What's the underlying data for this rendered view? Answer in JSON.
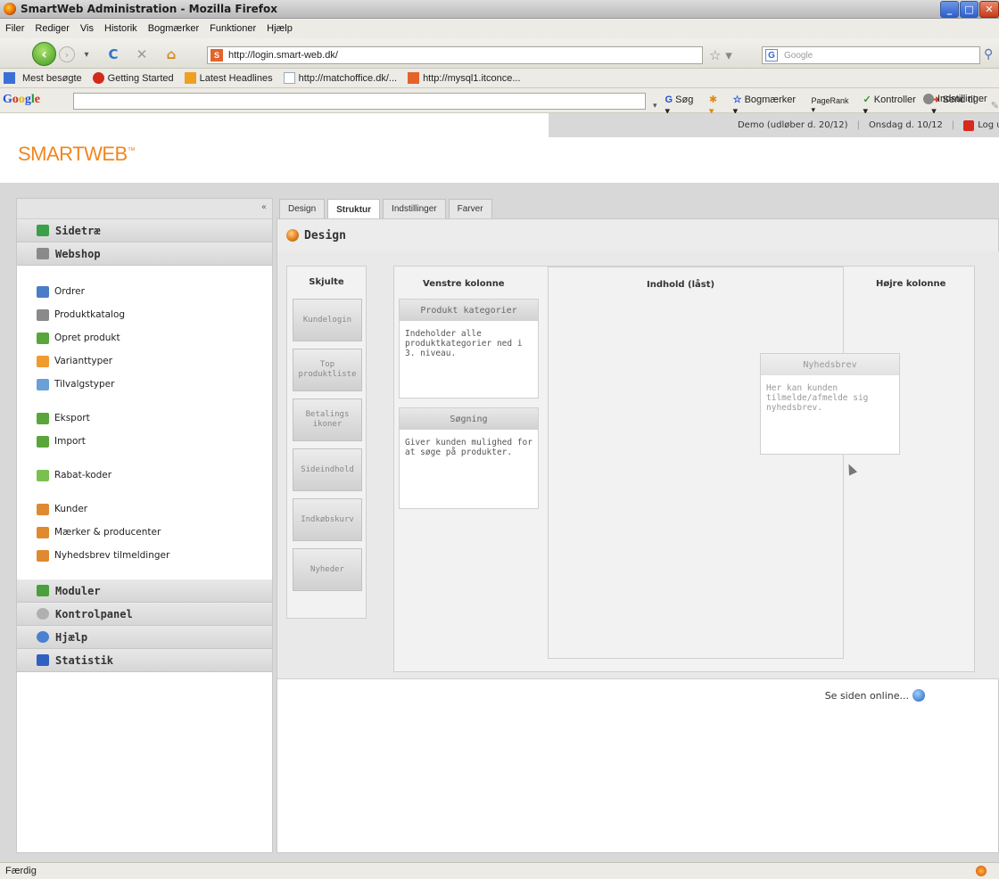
{
  "window": {
    "title": "SmartWeb Administration - Mozilla Firefox"
  },
  "menubar": [
    "Filer",
    "Rediger",
    "Vis",
    "Historik",
    "Bogmærker",
    "Funktioner",
    "Hjælp"
  ],
  "navbar": {
    "url": "http://login.smart-web.dk/",
    "search_placeholder": "Google"
  },
  "bookmarks": [
    {
      "label": "Mest besøgte",
      "color": "#3a6fd6"
    },
    {
      "label": "Getting Started",
      "color": "#d22a1a"
    },
    {
      "label": "Latest Headlines",
      "color": "#f0a020"
    },
    {
      "label": "http://matchoffice.dk/...",
      "color": "#ffffff"
    },
    {
      "label": "http://mysql1.itconce...",
      "color": "#e4632a"
    }
  ],
  "gtoolbar": {
    "logo": "Google",
    "items": [
      "Søg",
      "Bogmærker",
      "PageRank",
      "Kontroller",
      "Send til"
    ],
    "settings": "Indstillinger"
  },
  "page": {
    "brand": "SMARTWEB",
    "brand_tm": "™",
    "status_left": "Demo (udløber d. 20/12)",
    "status_date": "Onsdag d. 10/12",
    "logout": "Log ud",
    "collapse": "«",
    "sidebar": {
      "sections_top": [
        {
          "label": "Sidetræ",
          "icon": "sitemap-icon",
          "color": "#3aa04a"
        },
        {
          "label": "Webshop",
          "icon": "cart-icon",
          "color": "#8a8a8a"
        }
      ],
      "groups": [
        [
          {
            "label": "Ordrer",
            "icon": "order-icon",
            "color": "#4b7cc8"
          },
          {
            "label": "Produktkatalog",
            "icon": "catalog-icon",
            "color": "#8a8a8a"
          },
          {
            "label": "Opret produkt",
            "icon": "add-product-icon",
            "color": "#5aa63a"
          },
          {
            "label": "Varianttyper",
            "icon": "variant-icon",
            "color": "#f09a30"
          },
          {
            "label": "Tilvalgstyper",
            "icon": "option-icon",
            "color": "#6aa0d8"
          }
        ],
        [
          {
            "label": "Eksport",
            "icon": "export-icon",
            "color": "#5aa63a"
          },
          {
            "label": "Import",
            "icon": "import-icon",
            "color": "#5aa63a"
          }
        ],
        [
          {
            "label": "Rabat-koder",
            "icon": "discount-icon",
            "color": "#7ac050"
          }
        ],
        [
          {
            "label": "Kunder",
            "icon": "customers-icon",
            "color": "#e08a30"
          },
          {
            "label": "Mærker & producenter",
            "icon": "brands-icon",
            "color": "#e08a30"
          },
          {
            "label": "Nyhedsbrev tilmeldinger",
            "icon": "newsletter-icon",
            "color": "#e08a30"
          }
        ]
      ],
      "sections_bottom": [
        {
          "label": "Moduler",
          "icon": "puzzle-icon",
          "color": "#4aa03a"
        },
        {
          "label": "Kontrolpanel",
          "icon": "gear-icon",
          "color": "#b0b0b0"
        },
        {
          "label": "Hjælp",
          "icon": "help-icon",
          "color": "#4a80d0"
        },
        {
          "label": "Statistik",
          "icon": "chart-icon",
          "color": "#3060c0"
        }
      ]
    },
    "tabs": [
      {
        "label": "Design",
        "active": false
      },
      {
        "label": "Struktur",
        "active": true
      },
      {
        "label": "Indstillinger",
        "active": false
      },
      {
        "label": "Farver",
        "active": false
      }
    ],
    "content_title": "Design",
    "hidden_column": {
      "title": "Skjulte",
      "items": [
        "Kundelogin",
        "Top produktliste",
        "Betalings ikoner",
        "Sideindhold",
        "Indkøbskurv",
        "Nyheder"
      ]
    },
    "columns": {
      "left": "Venstre kolonne",
      "middle": "Indhold (låst)",
      "right": "Højre kolonne"
    },
    "left_modules": [
      {
        "title": "Produkt kategorier",
        "body": "Indeholder alle produktkategorier ned i 3. niveau."
      },
      {
        "title": "Søgning",
        "body": "Giver kunden mulighed for at søge på produkter."
      }
    ],
    "dragging_module": {
      "title": "Nyhedsbrev",
      "body": "Her kan kunden tilmelde/afmelde sig nyhedsbrev."
    },
    "view_online": "Se siden online..."
  },
  "statusbar": {
    "text": "Færdig"
  }
}
